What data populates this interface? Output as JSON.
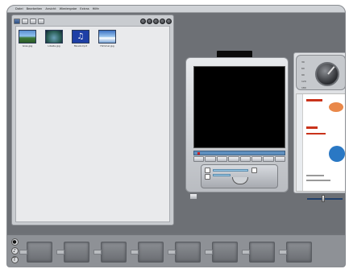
{
  "menubar": {
    "items": [
      "Datei",
      "Bearbeiten",
      "Ansicht",
      "Wiedergabe",
      "Extras",
      "Hilfe"
    ]
  },
  "album": {
    "photos": [
      {
        "caption": "Gras.jpg"
      },
      {
        "caption": "Libelle.jpg"
      },
      {
        "caption": "Musik.mp3"
      },
      {
        "caption": "Himmel.jpg"
      }
    ]
  },
  "player": {
    "screen_state": "blank",
    "progress": 0.03
  },
  "dial": {
    "labels": [
      "30",
      "60",
      "90",
      "120",
      "180"
    ]
  },
  "zoom": {
    "level": 0.45
  },
  "filmstrip": {
    "slots": 8
  },
  "colors": {
    "frame": "#6d7075",
    "progress": "#5e8fbf",
    "accent_red": "#c9331b"
  }
}
